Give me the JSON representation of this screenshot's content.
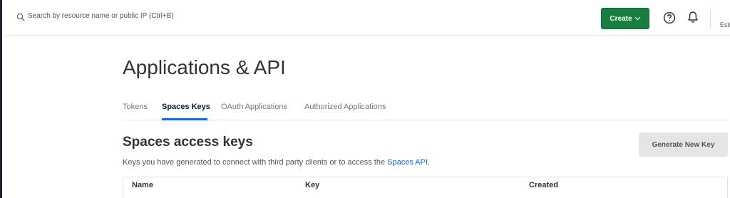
{
  "topbar": {
    "search_placeholder": "Search by resource name or public IP (Ctrl+B)",
    "create_label": "Create",
    "estimate_text": "Esti"
  },
  "page": {
    "title": "Applications & API"
  },
  "tabs": [
    {
      "label": "Tokens",
      "active": false
    },
    {
      "label": "Spaces Keys",
      "active": true
    },
    {
      "label": "OAuth Applications",
      "active": false
    },
    {
      "label": "Authorized Applications",
      "active": false
    }
  ],
  "section": {
    "title": "Spaces access keys",
    "generate_label": "Generate New Key",
    "description_prefix": "Keys you have generated to connect with third party clients or to access the ",
    "description_link": "Spaces API",
    "description_suffix": "."
  },
  "table": {
    "columns": [
      "Name",
      "Key",
      "Created"
    ]
  },
  "colors": {
    "accent": "#0069ff",
    "create_button": "#15803d",
    "active_tab": "#031b4e"
  },
  "icons": {
    "search": "search-icon",
    "help": "help-circle-icon",
    "bell": "bell-icon",
    "chevron": "chevron-down-icon"
  }
}
